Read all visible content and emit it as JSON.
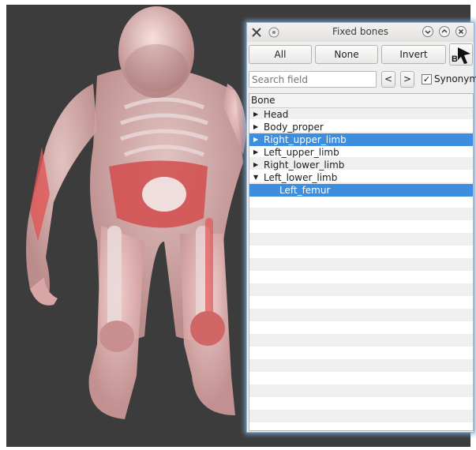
{
  "window": {
    "title": "Fixed bones"
  },
  "toolbar": {
    "all_label": "All",
    "none_label": "None",
    "invert_label": "Invert",
    "picker_letter": "B"
  },
  "search": {
    "placeholder": "Search field",
    "value": ""
  },
  "nav": {
    "prev_label": "<",
    "next_label": ">"
  },
  "synonym": {
    "label": "Synonym",
    "checked": true,
    "check_glyph": "✓"
  },
  "tree": {
    "header": "Bone",
    "rows": [
      {
        "label": "Head",
        "arrow": "▶",
        "selected": false
      },
      {
        "label": "Body_proper",
        "arrow": "▶",
        "selected": false
      },
      {
        "label": "Right_upper_limb",
        "arrow": "▶",
        "selected": true
      },
      {
        "label": "Left_upper_limb",
        "arrow": "▶",
        "selected": false
      },
      {
        "label": "Right_lower_limb",
        "arrow": "▶",
        "selected": false
      },
      {
        "label": "Left_lower_limb",
        "arrow": "▼",
        "selected": false
      },
      {
        "label": "Left_femur",
        "arrow": "",
        "selected": true
      }
    ]
  },
  "colors": {
    "selection": "#3d8ede",
    "viewport_bg": "#3c3c3c",
    "skin": "#e8b4b4",
    "bone_highlight": "#e05555"
  },
  "icons": {
    "app": "wrench-screwdriver-icon",
    "pin": "pin-icon",
    "minimize": "chevron-down-icon",
    "maximize": "chevron-up-icon",
    "close": "close-icon",
    "picker": "arrow-cursor-icon"
  }
}
